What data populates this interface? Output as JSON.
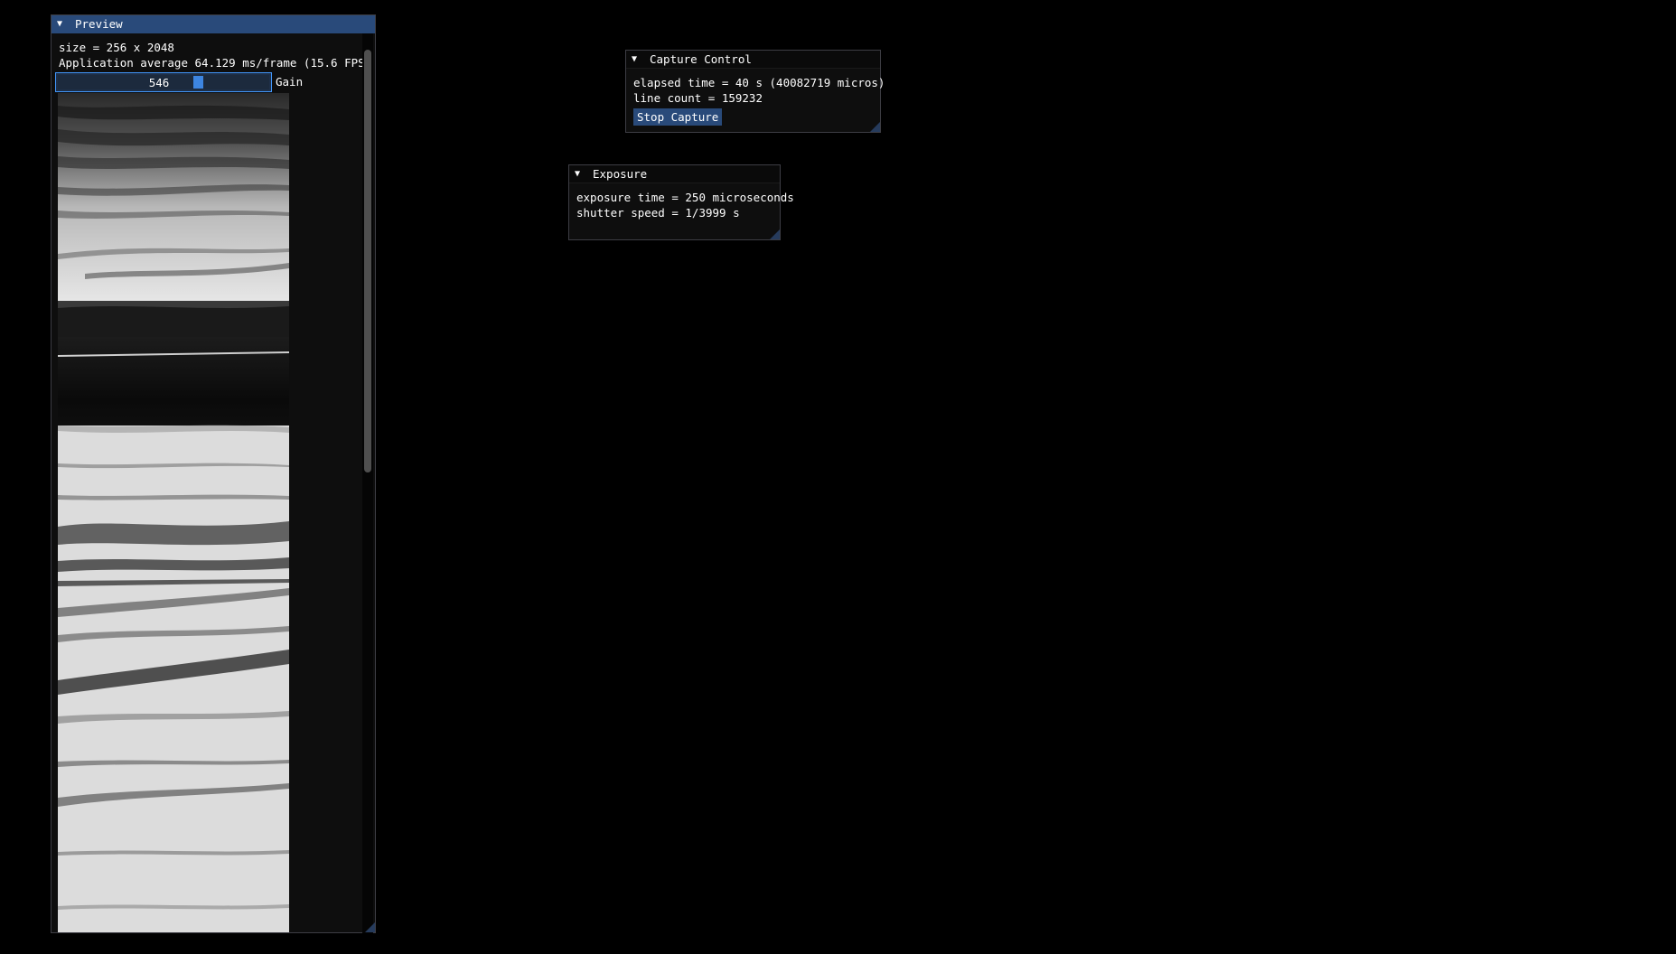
{
  "preview": {
    "title": "Preview",
    "size_text": "size = 256 x 2048",
    "fps_text": "Application average 64.129 ms/frame (15.6 FPS)",
    "gain": {
      "value": "546",
      "label": "Gain"
    }
  },
  "capture_control": {
    "title": "Capture Control",
    "elapsed_text": "elapsed time = 40 s (40082719 micros)",
    "line_count_text": "line count = 159232",
    "stop_button_label": "Stop Capture"
  },
  "exposure": {
    "title": "Exposure",
    "exposure_time_text": "exposure time = 250 microseconds",
    "shutter_speed_text": "shutter speed = 1/3999 s"
  },
  "colors": {
    "title_active": "#294a7a",
    "button": "#294a7a",
    "slider_grab": "#3d85e0",
    "slider_border": "#4296fa",
    "background": "#000000",
    "window_bg": "#0f0f0f"
  },
  "icons": {
    "collapse": "triangle-down-icon",
    "resize": "resize-grip-icon"
  }
}
